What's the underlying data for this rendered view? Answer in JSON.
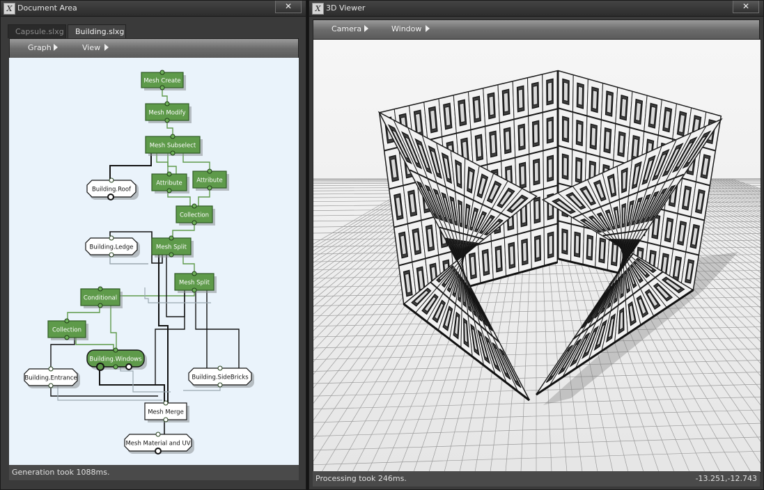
{
  "left_panel": {
    "title": "Document Area",
    "close_label": "✕",
    "tabs": [
      {
        "label": "Capsule.slxg",
        "active": false
      },
      {
        "label": "Building.slxg",
        "active": true
      }
    ],
    "menu": [
      {
        "label": "Graph"
      },
      {
        "label": "View"
      }
    ],
    "graph": {
      "nodes": [
        {
          "id": "mesh-create",
          "label": "Mesh Create",
          "style": "green"
        },
        {
          "id": "mesh-modify",
          "label": "Mesh Modify",
          "style": "green"
        },
        {
          "id": "mesh-subselect",
          "label": "Mesh Subselect",
          "style": "green"
        },
        {
          "id": "attribute-1",
          "label": "Attribute",
          "style": "green"
        },
        {
          "id": "attribute-2",
          "label": "Attribute",
          "style": "green"
        },
        {
          "id": "building-roof",
          "label": "Building.Roof",
          "style": "white"
        },
        {
          "id": "collection-1",
          "label": "Collection",
          "style": "green"
        },
        {
          "id": "building-ledge",
          "label": "Building.Ledge",
          "style": "white"
        },
        {
          "id": "mesh-split-1",
          "label": "Mesh Split",
          "style": "green"
        },
        {
          "id": "mesh-split-2",
          "label": "Mesh Split",
          "style": "green"
        },
        {
          "id": "conditional",
          "label": "Conditional",
          "style": "green"
        },
        {
          "id": "collection-2",
          "label": "Collection",
          "style": "green"
        },
        {
          "id": "building-windows",
          "label": "Building.Windows",
          "style": "green-rounded"
        },
        {
          "id": "building-entrance",
          "label": "Building.Entrance",
          "style": "white"
        },
        {
          "id": "building-sidebricks",
          "label": "Building.SideBricks",
          "style": "white"
        },
        {
          "id": "mesh-merge",
          "label": "Mesh Merge",
          "style": "white-rect"
        },
        {
          "id": "mesh-material-uv",
          "label": "Mesh Material and UV",
          "style": "white"
        }
      ]
    },
    "status": "Generation took 1088ms."
  },
  "right_panel": {
    "title": "3D Viewer",
    "close_label": "✕",
    "menu": [
      {
        "label": "Camera"
      },
      {
        "label": "Window"
      }
    ],
    "status": "Processing took 246ms.",
    "coordinates": "-13.251,-12.743"
  },
  "colors": {
    "node_green": "#5e9a4a",
    "node_green_border": "#2f5a24",
    "canvas_bg": "#eaf3fb",
    "panel_bg": "#3a3a3a",
    "viewport_bg": "#f1f1f1"
  }
}
